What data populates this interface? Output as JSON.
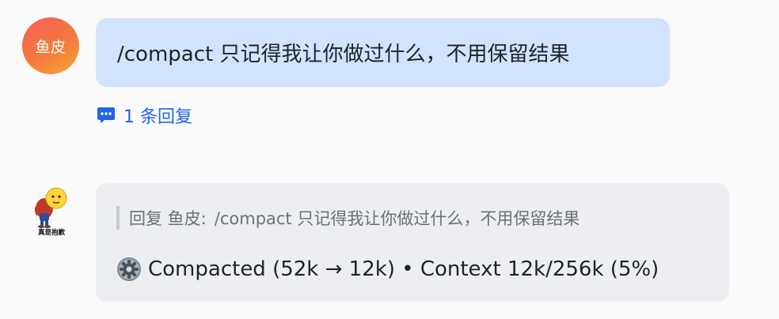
{
  "user_message": {
    "avatar_label": "鱼皮",
    "text": "/compact 只记得我让你做过什么，不用保留结果",
    "reply_link": {
      "icon": "chat-bubble-icon",
      "label": "1 条回复"
    }
  },
  "bot_message": {
    "avatar_caption": "真是抱歉",
    "quote": {
      "prefix": "回复 鱼皮:",
      "text": "/compact 只记得我让你做过什么，不用保留结果"
    },
    "status": {
      "icon": "gear-icon",
      "text": "Compacted (52k → 12k) • Context 12k/256k (5%)"
    }
  },
  "colors": {
    "background": "#fafafb",
    "user_bubble": "#d2e3fd",
    "bot_bubble": "#eceef1",
    "link": "#2463eb",
    "avatar_gradient_start": "#f25e5e",
    "avatar_gradient_end": "#f7a53a"
  }
}
